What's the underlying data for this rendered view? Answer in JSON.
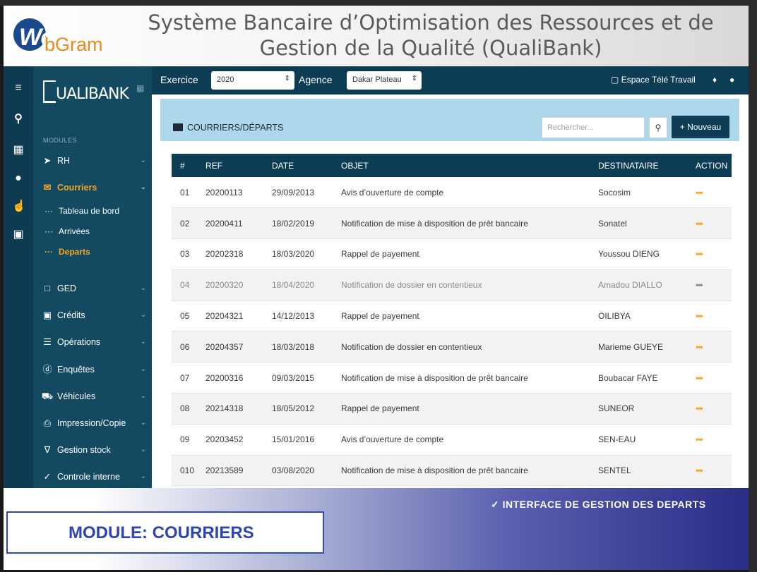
{
  "header": {
    "logo_we": "We",
    "logo_gram": "bGram",
    "title_line1": "Système Bancaire d’Optimisation des Ressources et de",
    "title_line2": "Gestion de la Qualité (QualiBank)"
  },
  "sidebar": {
    "brand": "UALIBANK",
    "modules_label": "MODULES",
    "items": [
      {
        "label": "RH",
        "icon": "rocket-icon"
      },
      {
        "label": "Courriers",
        "icon": "mail-open-icon"
      },
      {
        "label": "GED",
        "icon": "folder-icon"
      },
      {
        "label": "Crédits",
        "icon": "folder-credit-icon"
      },
      {
        "label": "Opérations",
        "icon": "list-icon"
      },
      {
        "label": "Enquêtes",
        "icon": "question-icon"
      },
      {
        "label": "Véhicules",
        "icon": "car-icon"
      },
      {
        "label": "Impression/Copie",
        "icon": "printer-icon"
      },
      {
        "label": "Gestion stock",
        "icon": "cart-icon"
      },
      {
        "label": "Controle interne",
        "icon": "check-circle-icon"
      }
    ],
    "sub_items": [
      {
        "label": "Tableau de bord"
      },
      {
        "label": "Arrivées"
      },
      {
        "label": "Departs"
      }
    ]
  },
  "toolbar": {
    "exercice_label": "Exercice",
    "exercice_value": "2020",
    "agence_label": "Agence",
    "agence_value": "Dakar Plateau",
    "espace": "Espace Télé Travail"
  },
  "panel": {
    "title": "COURRIERS/DÉPARTS",
    "search_placeholder": "Rechercher...",
    "new_button": "+ Nouveau"
  },
  "table": {
    "headers": [
      "#",
      "REF",
      "DATE",
      "OBJET",
      "DESTINATAIRE",
      "ACTION"
    ],
    "rows": [
      [
        "01",
        "20200113",
        "29/09/2013",
        "Avis d’ouverture de compte",
        "Socosim",
        "•••"
      ],
      [
        "02",
        "20200411",
        "18/02/2019",
        "Notification de mise à disposition de prêt bancaire",
        "Sonatel",
        "•••"
      ],
      [
        "03",
        "20202318",
        "18/03/2020",
        "Rappel de payement",
        "Youssou DIENG",
        "•••"
      ],
      [
        "04",
        "20200320",
        "18/04/2020",
        "Notification de dossier en contentieux",
        "Amadou DIALLO",
        "•••"
      ],
      [
        "05",
        "20204321",
        "14/12/2013",
        "Rappel de payement",
        "OILIBYA",
        "•••"
      ],
      [
        "06",
        "20204357",
        "18/03/2018",
        "Notification de dossier en contentieux",
        "Marieme GUEYE",
        "•••"
      ],
      [
        "07",
        "20200316",
        "09/03/2015",
        "Notification de mise à disposition de prêt bancaire",
        "Boubacar FAYE",
        "•••"
      ],
      [
        "08",
        "20214318",
        "18/05/2012",
        "Rappel de payement",
        "SUNEOR",
        "•••"
      ],
      [
        "09",
        "20203452",
        "15/01/2016",
        "Avis d’ouverture de compte",
        "SEN-EAU",
        "•••"
      ],
      [
        "010",
        "20213589",
        "03/08/2020",
        "Notification de mise à disposition de prêt bancaire",
        "SENTEL",
        "•••"
      ]
    ]
  },
  "footer": {
    "module": "MODULE: COURRIERS",
    "note": "✓ INTERFACE DE GESTION DES DEPARTS"
  },
  "colors": {
    "sidebar": "#134a62",
    "toolbar": "#0d3c55",
    "accent": "#f5a623",
    "panel_header": "#add8ec"
  }
}
